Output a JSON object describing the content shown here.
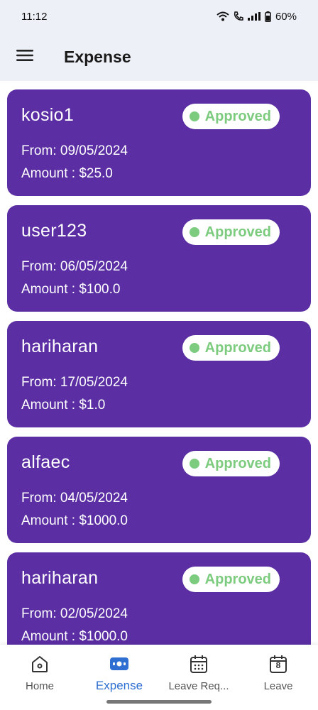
{
  "status_bar": {
    "time": "11:12",
    "battery": "60%"
  },
  "app_bar": {
    "title": "Expense"
  },
  "expenses": [
    {
      "name": "kosio1",
      "status": "Approved",
      "from": "From: 09/05/2024",
      "amount": "Amount : $25.0"
    },
    {
      "name": "user123",
      "status": "Approved",
      "from": "From: 06/05/2024",
      "amount": "Amount : $100.0"
    },
    {
      "name": "hariharan",
      "status": "Approved",
      "from": "From: 17/05/2024",
      "amount": "Amount : $1.0"
    },
    {
      "name": "alfaec",
      "status": "Approved",
      "from": "From: 04/05/2024",
      "amount": "Amount : $1000.0"
    },
    {
      "name": "hariharan",
      "status": "Approved",
      "from": "From: 02/05/2024",
      "amount": "Amount : $1000.0"
    }
  ],
  "nav": [
    {
      "label": "Home",
      "icon": "home-icon"
    },
    {
      "label": "Expense",
      "icon": "expense-icon",
      "active": true
    },
    {
      "label": "Leave Req...",
      "icon": "calendar-grid-icon"
    },
    {
      "label": "Leave",
      "icon": "calendar-day-icon",
      "day": "8"
    }
  ],
  "colors": {
    "card": "#5b2ea3",
    "approved": "#7ccb7e",
    "active_nav": "#2f6fd1",
    "app_bar_bg": "#eef0f8"
  }
}
